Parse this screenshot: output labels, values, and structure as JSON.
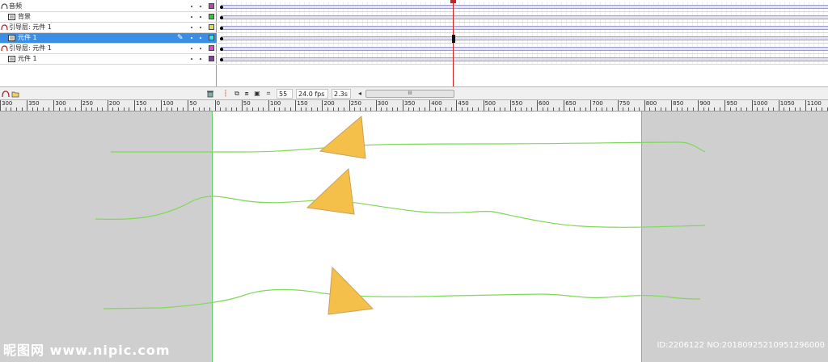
{
  "layers": [
    {
      "name": "音频",
      "type": "audio",
      "color": "#c040c0",
      "selected": false
    },
    {
      "name": "背景",
      "type": "layer",
      "color": "#40c040",
      "selected": false
    },
    {
      "name": "引导层: 元件 1",
      "type": "guide",
      "color": "#e0e040",
      "selected": false
    },
    {
      "name": "元件 1",
      "type": "layer",
      "color": "#40e0e0",
      "selected": true
    },
    {
      "name": "引导层: 元件 1",
      "type": "guide",
      "color": "#e040e0",
      "selected": false
    },
    {
      "name": "元件 1",
      "type": "layer",
      "color": "#8040a0",
      "selected": false
    }
  ],
  "timeline_bar": {
    "current_frame": "55",
    "frame_rate": "24.0 fps",
    "elapsed_time": "2.3s",
    "scroll_glyph": "III"
  },
  "ruler": {
    "labels": [
      "300",
      "350",
      "300",
      "250",
      "200",
      "150",
      "100",
      "50",
      "0",
      "50",
      "100",
      "150",
      "200",
      "250",
      "300",
      "350",
      "400",
      "450",
      "500",
      "550",
      "600",
      "650",
      "700",
      "750",
      "800",
      "850",
      "900",
      "950",
      "1000",
      "1050",
      "1100"
    ]
  },
  "icons": {
    "layer": "layer-icon",
    "guide": "guide-layer-icon",
    "audio": "audio-layer-icon",
    "pencil": "pencil-icon",
    "trash": "trash-icon"
  },
  "colors": {
    "selection": "#3a8ee6",
    "stage_bg": "#cfcfcf",
    "guide_line": "#7ed957",
    "triangle": "#f5c04a",
    "playhead": "#cc2222"
  },
  "watermark": {
    "left": "昵图网 www.nipic.com",
    "right": "ID:2206122 NO:20180925210951296000"
  }
}
